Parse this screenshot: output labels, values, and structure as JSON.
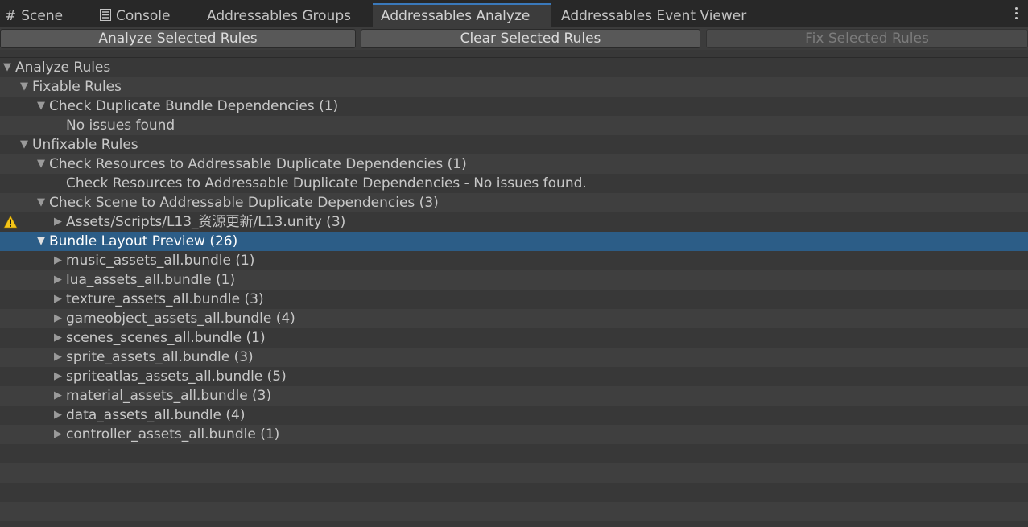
{
  "tabs": [
    {
      "label": "Scene",
      "icon": "grid-icon"
    },
    {
      "label": "Console",
      "icon": "console-icon"
    },
    {
      "label": "Addressables Groups"
    },
    {
      "label": "Addressables Analyze",
      "active": true
    },
    {
      "label": "Addressables Event Viewer"
    }
  ],
  "toolbar": {
    "analyze_label": "Analyze Selected Rules",
    "clear_label": "Clear Selected Rules",
    "fix_label": "Fix Selected Rules"
  },
  "tree": [
    {
      "label": "Analyze Rules",
      "depth": 0,
      "arrow": "expanded"
    },
    {
      "label": "Fixable Rules",
      "depth": 1,
      "arrow": "expanded"
    },
    {
      "label": "Check Duplicate Bundle Dependencies (1)",
      "depth": 2,
      "arrow": "expanded"
    },
    {
      "label": "No issues found",
      "depth": 3,
      "arrow": "none"
    },
    {
      "label": "Unfixable Rules",
      "depth": 1,
      "arrow": "expanded"
    },
    {
      "label": "Check Resources to Addressable Duplicate Dependencies (1)",
      "depth": 2,
      "arrow": "expanded"
    },
    {
      "label": "Check Resources to Addressable Duplicate Dependencies - No issues found.",
      "depth": 3,
      "arrow": "none"
    },
    {
      "label": "Check Scene to Addressable Duplicate Dependencies (3)",
      "depth": 2,
      "arrow": "expanded"
    },
    {
      "label": "Assets/Scripts/L13_资源更新/L13.unity (3)",
      "depth": 3,
      "arrow": "collapsed",
      "warning": true
    },
    {
      "label": "Bundle Layout Preview (26)",
      "depth": 2,
      "arrow": "expanded",
      "selected": true
    },
    {
      "label": "music_assets_all.bundle (1)",
      "depth": 3,
      "arrow": "collapsed"
    },
    {
      "label": "lua_assets_all.bundle (1)",
      "depth": 3,
      "arrow": "collapsed"
    },
    {
      "label": "texture_assets_all.bundle (3)",
      "depth": 3,
      "arrow": "collapsed"
    },
    {
      "label": "gameobject_assets_all.bundle (4)",
      "depth": 3,
      "arrow": "collapsed"
    },
    {
      "label": "scenes_scenes_all.bundle (1)",
      "depth": 3,
      "arrow": "collapsed"
    },
    {
      "label": "sprite_assets_all.bundle (3)",
      "depth": 3,
      "arrow": "collapsed"
    },
    {
      "label": "spriteatlas_assets_all.bundle (5)",
      "depth": 3,
      "arrow": "collapsed"
    },
    {
      "label": "material_assets_all.bundle (3)",
      "depth": 3,
      "arrow": "collapsed"
    },
    {
      "label": "data_assets_all.bundle (4)",
      "depth": 3,
      "arrow": "collapsed"
    },
    {
      "label": "controller_assets_all.bundle (1)",
      "depth": 3,
      "arrow": "collapsed"
    }
  ],
  "colors": {
    "selection": "#2c5d87",
    "tab_accent": "#3a79bb",
    "warning": "#f5c518"
  }
}
